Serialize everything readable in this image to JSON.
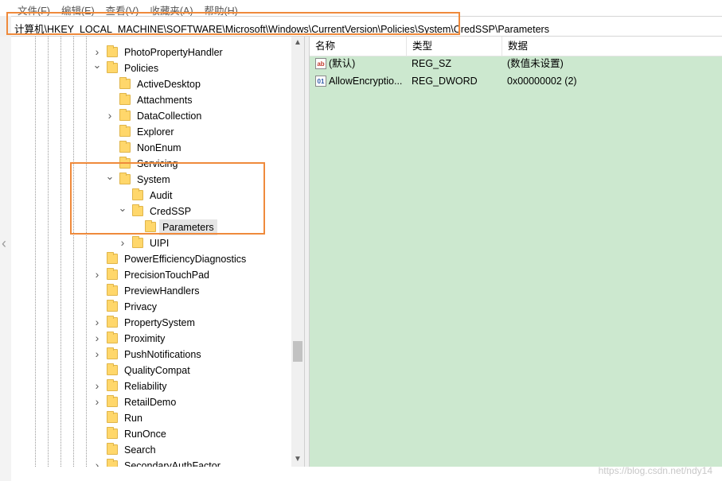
{
  "menu": {
    "items": [
      "文件(F)",
      "编辑(E)",
      "查看(V)",
      "收藏夹(A)",
      "帮助(H)"
    ]
  },
  "address": {
    "path": "计算机\\HKEY_LOCAL_MACHINE\\SOFTWARE\\Microsoft\\Windows\\CurrentVersion\\Policies\\System\\CredSSP\\Parameters"
  },
  "tree": {
    "items": [
      {
        "label": "PhotoPropertyHandler",
        "expand": "collapsed"
      },
      {
        "label": "Policies",
        "expand": "expanded"
      },
      {
        "label": "ActiveDesktop",
        "expand": "none"
      },
      {
        "label": "Attachments",
        "expand": "none"
      },
      {
        "label": "DataCollection",
        "expand": "collapsed"
      },
      {
        "label": "Explorer",
        "expand": "none"
      },
      {
        "label": "NonEnum",
        "expand": "none"
      },
      {
        "label": "Servicing",
        "expand": "none"
      },
      {
        "label": "System",
        "expand": "expanded"
      },
      {
        "label": "Audit",
        "expand": "none"
      },
      {
        "label": "CredSSP",
        "expand": "expanded"
      },
      {
        "label": "Parameters",
        "expand": "none",
        "selected": true
      },
      {
        "label": "UIPI",
        "expand": "collapsed"
      },
      {
        "label": "PowerEfficiencyDiagnostics",
        "expand": "none"
      },
      {
        "label": "PrecisionTouchPad",
        "expand": "collapsed"
      },
      {
        "label": "PreviewHandlers",
        "expand": "none"
      },
      {
        "label": "Privacy",
        "expand": "none"
      },
      {
        "label": "PropertySystem",
        "expand": "collapsed"
      },
      {
        "label": "Proximity",
        "expand": "collapsed"
      },
      {
        "label": "PushNotifications",
        "expand": "collapsed"
      },
      {
        "label": "QualityCompat",
        "expand": "none"
      },
      {
        "label": "Reliability",
        "expand": "collapsed"
      },
      {
        "label": "RetailDemo",
        "expand": "collapsed"
      },
      {
        "label": "Run",
        "expand": "none"
      },
      {
        "label": "RunOnce",
        "expand": "none"
      },
      {
        "label": "Search",
        "expand": "none"
      },
      {
        "label": "SecondaryAuthFactor",
        "expand": "collapsed"
      }
    ]
  },
  "values": {
    "headers": {
      "name": "名称",
      "type": "类型",
      "data": "数据"
    },
    "rows": [
      {
        "icon": "string-value-icon",
        "name": "(默认)",
        "type": "REG_SZ",
        "data": "(数值未设置)"
      },
      {
        "icon": "dword-value-icon",
        "name": "AllowEncryptio...",
        "type": "REG_DWORD",
        "data": "0x00000002 (2)"
      }
    ]
  },
  "watermark": "https://blog.csdn.net/ndy14",
  "colors": {
    "values_bg": "#cce8cf",
    "highlight": "#ef8a3c",
    "folder": "#ffd76b"
  }
}
